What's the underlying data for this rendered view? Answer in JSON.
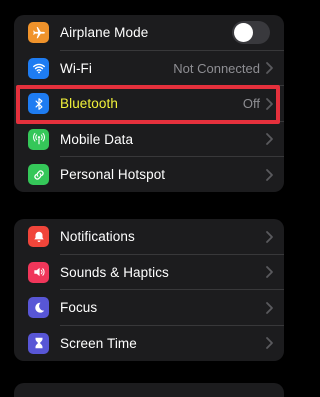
{
  "group1": {
    "airplane": {
      "label": "Airplane Mode",
      "toggle_on": false,
      "icon": "airplane-icon",
      "color": "#f0932b"
    },
    "wifi": {
      "label": "Wi-Fi",
      "value": "Not Connected",
      "icon": "wifi-icon",
      "color": "#1e7cf2"
    },
    "bluetooth": {
      "label": "Bluetooth",
      "value": "Off",
      "icon": "bluetooth-icon",
      "color": "#1e7cf2"
    },
    "mobile_data": {
      "label": "Mobile Data",
      "icon": "antenna-icon",
      "color": "#35c759"
    },
    "hotspot": {
      "label": "Personal Hotspot",
      "icon": "hotspot-link-icon",
      "color": "#35c759"
    }
  },
  "group2": {
    "notifications": {
      "label": "Notifications",
      "icon": "bell-icon",
      "color": "#f0453a"
    },
    "sounds": {
      "label": "Sounds & Haptics",
      "icon": "speaker-icon",
      "color": "#f0365a"
    },
    "focus": {
      "label": "Focus",
      "icon": "moon-icon",
      "color": "#5856d6"
    },
    "screen_time": {
      "label": "Screen Time",
      "icon": "hourglass-icon",
      "color": "#5856d6"
    }
  },
  "highlight": {
    "target": "bluetooth",
    "color": "#e5303c",
    "label_color": "#f2f23a"
  }
}
